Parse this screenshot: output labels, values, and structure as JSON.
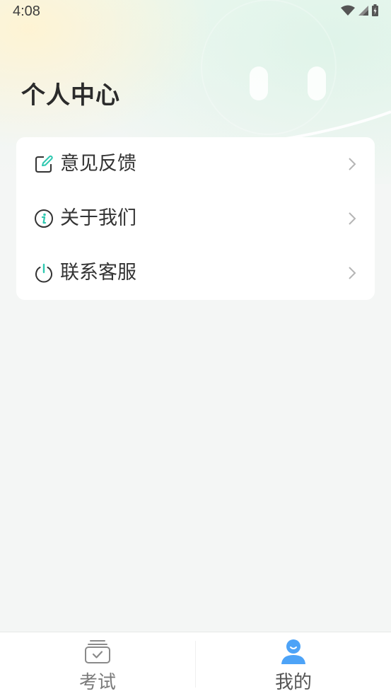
{
  "status_bar": {
    "time": "4:08",
    "icons": [
      "wifi-icon",
      "cellular-signal-icon",
      "battery-charging-icon"
    ]
  },
  "header": {
    "title": "个人中心"
  },
  "menu": {
    "items": [
      {
        "label": "意见反馈",
        "icon": "feedback-edit-icon"
      },
      {
        "label": "关于我们",
        "icon": "info-icon"
      },
      {
        "label": "联系客服",
        "icon": "power-icon"
      }
    ]
  },
  "bottom_nav": {
    "tabs": [
      {
        "label": "考试",
        "icon": "exam-box-icon",
        "active": false
      },
      {
        "label": "我的",
        "icon": "user-profile-icon",
        "active": true
      }
    ]
  },
  "colors": {
    "accent": "#2ec8b0",
    "active_tab_icon": "#4da3f7",
    "inactive_tab": "#7a7a7a",
    "active_tab_label": "#555555"
  }
}
